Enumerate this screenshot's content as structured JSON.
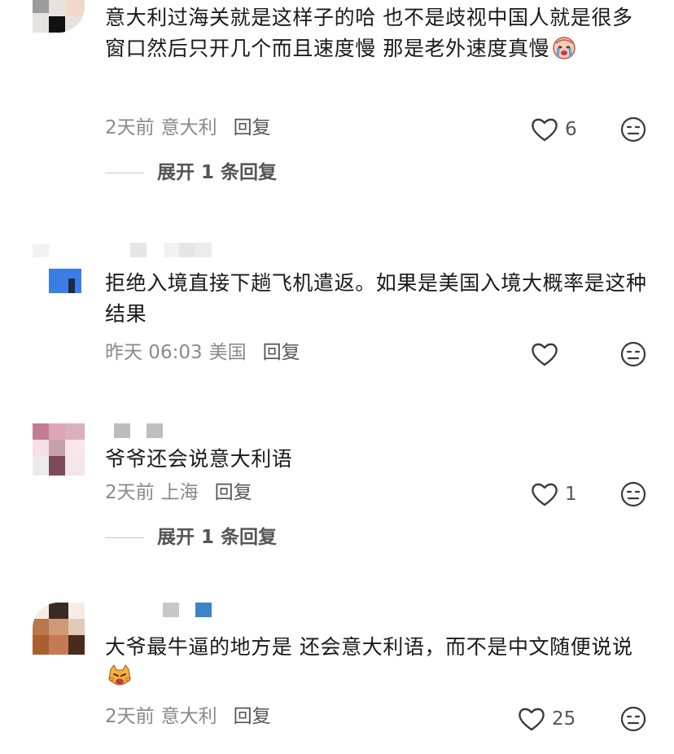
{
  "comments": [
    {
      "text": "意大利过海关就是这样子的哈 也不是歧视中国人就是很多窗口然后只开几个而且速度慢 那是老外速度真慢",
      "emoji": "crying-face-emoji",
      "date": "2天前",
      "location": "意大利",
      "reply_label": "回复",
      "like_count": "6",
      "expand_label": "展开 1 条回复"
    },
    {
      "text": "拒绝入境直接下趟飞机遣返。如果是美国入境大概率是这种结果",
      "date": "昨天 06:03",
      "location": "美国",
      "reply_label": "回复",
      "like_count": ""
    },
    {
      "text": "爷爷还会说意大利语",
      "date": "2天前",
      "location": "上海",
      "reply_label": "回复",
      "like_count": "1",
      "expand_label": "展开 1 条回复"
    },
    {
      "text": "大爷最牛逼的地方是 还会意大利语，而不是中文随便说说",
      "emoji": "angry-cat-emoji",
      "date": "2天前",
      "location": "意大利",
      "reply_label": "回复",
      "like_count": "25"
    }
  ],
  "icons": {
    "like": "heart-icon",
    "dislike": "meh-face-icon"
  },
  "colors": {
    "text": "#1a1a1a",
    "meta": "#8a8a8a",
    "icon": "#3a3a3a"
  }
}
